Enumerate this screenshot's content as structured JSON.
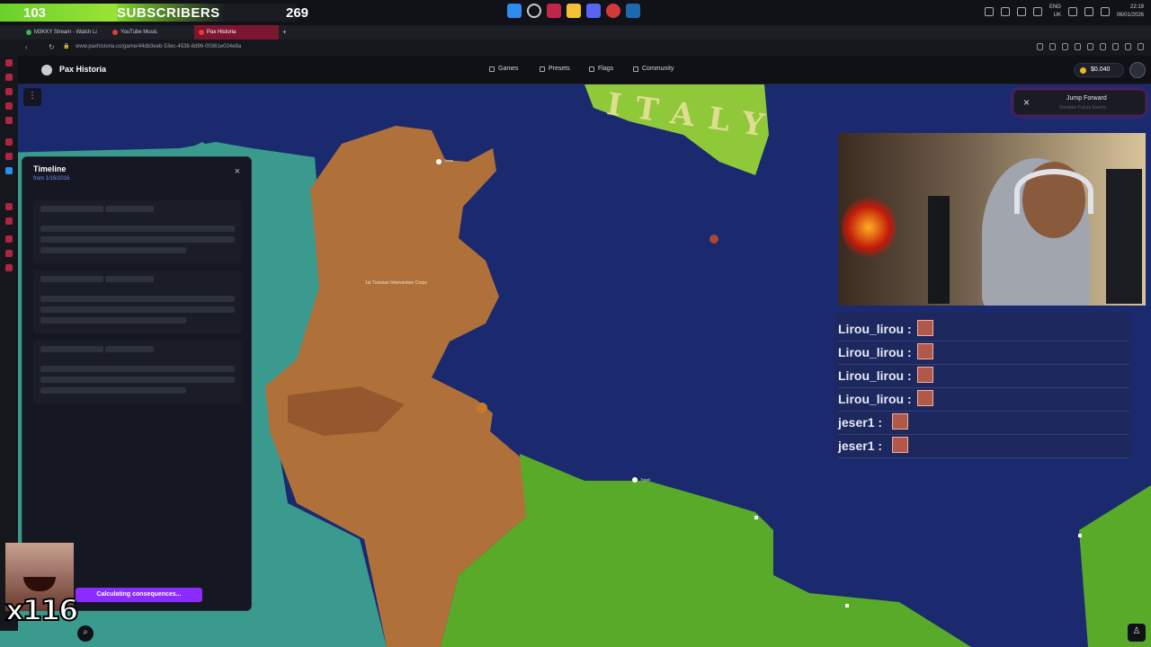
{
  "stream_overlay": {
    "subscriber_left_count": "103",
    "subscriber_label": "SUBSCRIBERS",
    "subscriber_right_count": "269",
    "meme_multiplier": "x116"
  },
  "system_tray": {
    "lang": "ENG",
    "region": "UK",
    "time": "22:19",
    "date": "06/01/2026"
  },
  "browser": {
    "tabs": [
      {
        "label": "M3KKY Stream - Watch Li",
        "color": "#3bb44a"
      },
      {
        "label": "YouTube Music",
        "color": "#e53935"
      },
      {
        "label": "Pax Historia",
        "color": "#e53935"
      }
    ],
    "new_tab": "+",
    "url": "www.paxhistoria.co/game/44db3eeb-53ec-4538-8d96-00361e024e8a"
  },
  "app": {
    "brand": "Pax Historia",
    "nav": [
      {
        "label": "Games",
        "icon": "gamepad-icon"
      },
      {
        "label": "Presets",
        "icon": "play-icon"
      },
      {
        "label": "Flags",
        "icon": "flag-icon"
      },
      {
        "label": "Community",
        "icon": "users-icon"
      }
    ],
    "balance": "$0.040"
  },
  "map": {
    "country_label": "ITALY",
    "unit_label": "1st Tunisian Intervention Corps",
    "cities": [
      "Tunis",
      "Tripoli"
    ],
    "colors": {
      "sea": "#1b2a6e",
      "tunisia": "#b0703a",
      "algeria": "#3a9a8e",
      "libya": "#5aaa2a",
      "italy": "#8fc93a"
    }
  },
  "timeline": {
    "title": "Timeline",
    "subtitle": "from 1/16/2016",
    "close": "×"
  },
  "status": {
    "calculating": "Calculating consequences..."
  },
  "jump": {
    "title": "Jump Forward",
    "subtitle": "Simulate Future Events",
    "close": "×"
  },
  "chat": [
    {
      "user": "Lirou_lirou :"
    },
    {
      "user": "Lirou_lirou :"
    },
    {
      "user": "Lirou_lirou :"
    },
    {
      "user": "Lirou_lirou :"
    },
    {
      "user": "jeser1 :"
    },
    {
      "user": "jeser1 :"
    }
  ]
}
